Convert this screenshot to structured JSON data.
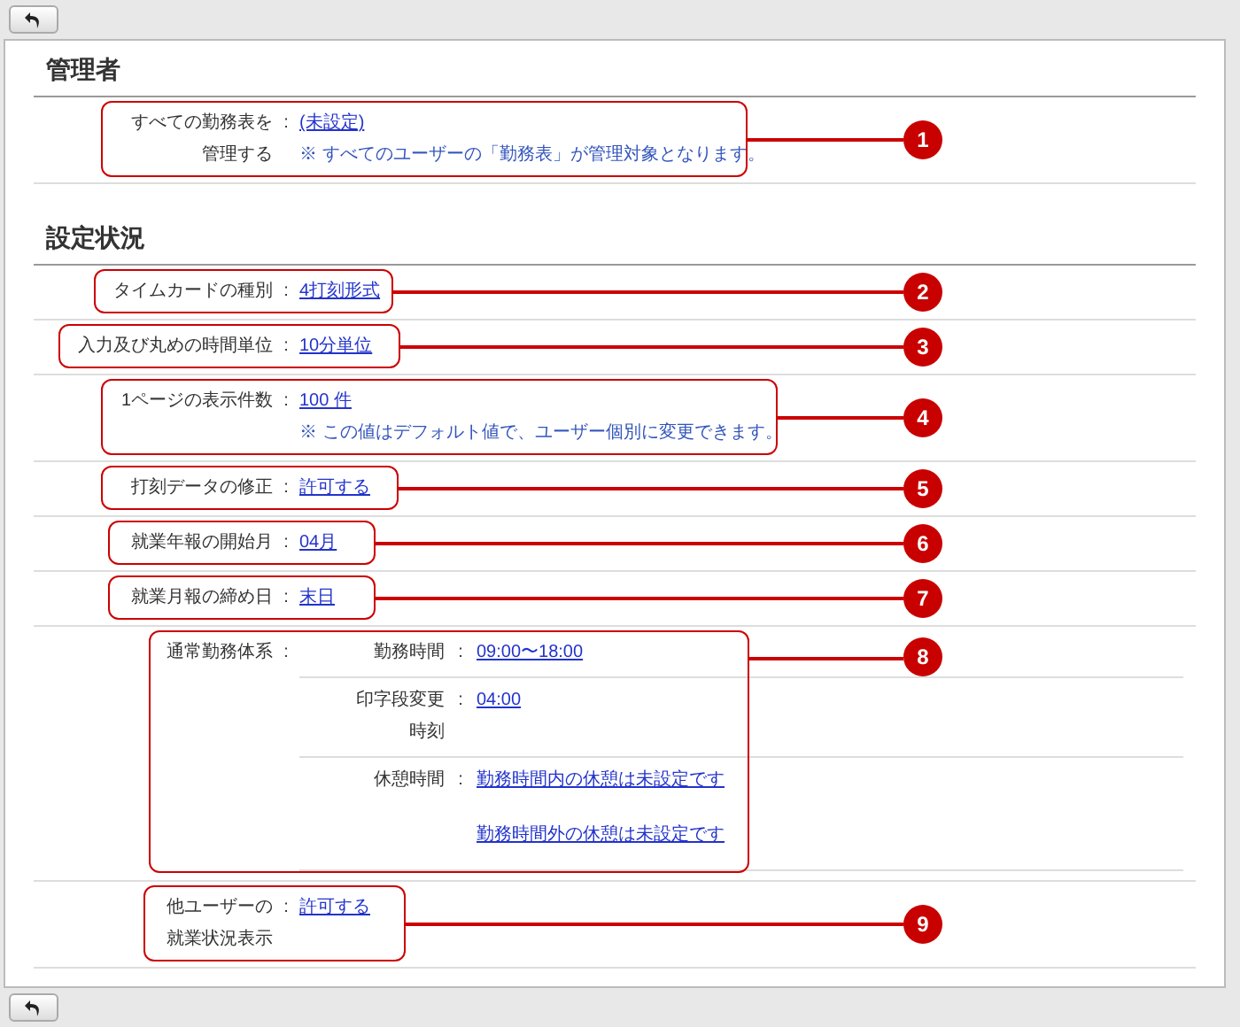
{
  "sections": [
    {
      "title": "管理者",
      "rows": [
        {
          "kind": "setting",
          "label_lines": [
            "すべての勤務表を",
            "管理する"
          ],
          "separator": ":",
          "values": [
            "(未設定)"
          ],
          "note": "※ すべてのユーザーの「勤務表」が管理対象となります。",
          "callout": "1"
        }
      ]
    },
    {
      "title": "設定状況",
      "rows": [
        {
          "kind": "setting",
          "label_lines": [
            "タイムカードの種別"
          ],
          "separator": ":",
          "values": [
            "4打刻形式"
          ],
          "callout": "2"
        },
        {
          "kind": "setting",
          "label_lines": [
            "入力及び丸めの時間単位"
          ],
          "separator": ":",
          "values": [
            "10分単位"
          ],
          "callout": "3"
        },
        {
          "kind": "setting",
          "label_lines": [
            "1ページの表示件数"
          ],
          "separator": ":",
          "values": [
            "100 件"
          ],
          "note": "※ この値はデフォルト値で、ユーザー個別に変更できます。",
          "callout": "4"
        },
        {
          "kind": "setting",
          "label_lines": [
            "打刻データの修正"
          ],
          "separator": ":",
          "values": [
            "許可する"
          ],
          "callout": "5"
        },
        {
          "kind": "setting",
          "label_lines": [
            "就業年報の開始月"
          ],
          "separator": ":",
          "values": [
            "04月"
          ],
          "callout": "6"
        },
        {
          "kind": "setting",
          "label_lines": [
            "就業月報の締め日"
          ],
          "separator": ":",
          "values": [
            "末日"
          ],
          "callout": "7"
        },
        {
          "kind": "group",
          "label_lines": [
            "通常勤務体系"
          ],
          "separator": ":",
          "subrows": [
            {
              "label_lines": [
                "勤務時間"
              ],
              "separator": ":",
              "values": [
                "09:00〜18:00"
              ]
            },
            {
              "label_lines": [
                "印字段変更",
                "時刻"
              ],
              "separator": ":",
              "values": [
                "04:00"
              ]
            },
            {
              "label_lines": [
                "休憩時間"
              ],
              "separator": ":",
              "values": [
                "勤務時間内の休憩は未設定です",
                "勤務時間外の休憩は未設定です"
              ]
            }
          ],
          "callout": "8"
        },
        {
          "kind": "setting",
          "label_lines": [
            "他ユーザーの",
            "就業状況表示"
          ],
          "separator": ":",
          "values": [
            "許可する"
          ],
          "callout": "9"
        }
      ]
    }
  ]
}
